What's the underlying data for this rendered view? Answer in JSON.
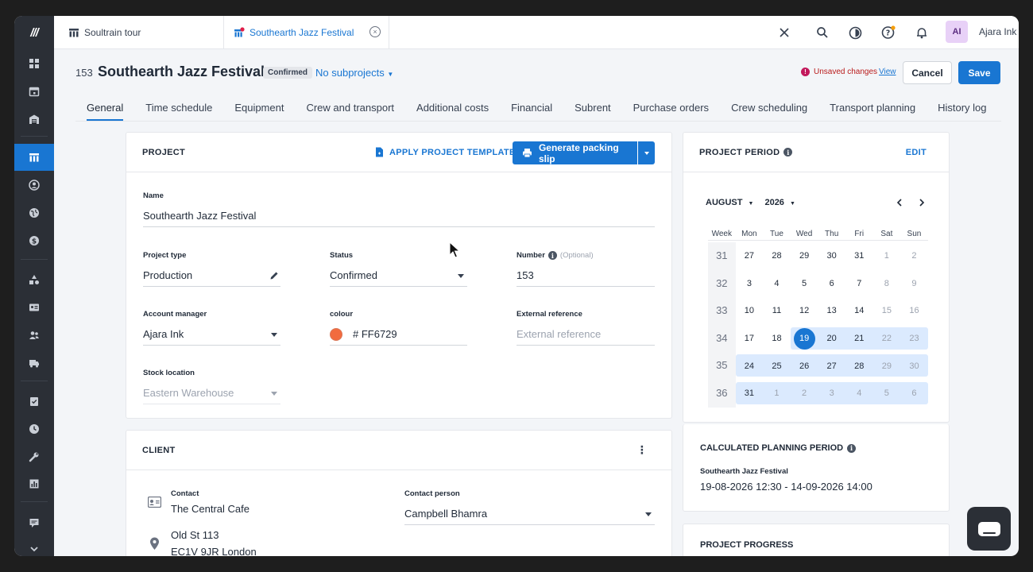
{
  "app": {
    "logo": "///"
  },
  "tabs": {
    "tab1": "Soultrain tour",
    "tab2": "Southearth Jazz Festival",
    "tab2_close": "×"
  },
  "topbar": {
    "user_initials": "AI",
    "user_name": "Ajara Ink"
  },
  "header": {
    "number": "153",
    "title": "Southearth Jazz Festival",
    "status_badge": "Confirmed",
    "subprojects": "No subprojects",
    "unsaved_icon": "!",
    "unsaved": "Unsaved changes",
    "view": "View",
    "cancel": "Cancel",
    "save": "Save"
  },
  "nav_tabs": [
    "General",
    "Time schedule",
    "Equipment",
    "Crew and transport",
    "Additional costs",
    "Financial",
    "Subrent",
    "Purchase orders",
    "Crew scheduling",
    "Transport planning",
    "History log"
  ],
  "project": {
    "section": "PROJECT",
    "apply_template": "APPLY PROJECT TEMPLATE",
    "generate": "Generate packing slip",
    "name_label": "Name",
    "name_value": "Southearth Jazz Festival",
    "type_label": "Project type",
    "type_value": "Production",
    "status_label": "Status",
    "status_value": "Confirmed",
    "number_label": "Number",
    "number_optional": "(Optional)",
    "number_value": "153",
    "manager_label": "Account manager",
    "manager_value": "Ajara Ink",
    "colour_label": "colour",
    "colour_value": "# FF6729",
    "colour_hex": "#F26B3F",
    "extref_label": "External reference",
    "extref_placeholder": "External reference",
    "stock_label": "Stock location",
    "stock_value": "Eastern Warehouse"
  },
  "client": {
    "section": "CLIENT",
    "menu_icon": "⋮",
    "contact_label": "Contact",
    "contact_value": "The Central Cafe",
    "person_label": "Contact person",
    "person_value": "Campbell Bhamra",
    "address_line1": "Old St 113",
    "address_line2": "EC1V 9JR London"
  },
  "period": {
    "section": "PROJECT PERIOD",
    "edit": "EDIT",
    "month": "AUGUST",
    "year": "2026",
    "week_header": "Week",
    "days": [
      "Mon",
      "Tue",
      "Wed",
      "Thu",
      "Fri",
      "Sat",
      "Sun"
    ],
    "weeks": [
      {
        "week": "31",
        "days": [
          "27",
          "28",
          "29",
          "30",
          "31",
          "1",
          "2"
        ]
      },
      {
        "week": "32",
        "days": [
          "3",
          "4",
          "5",
          "6",
          "7",
          "8",
          "9"
        ]
      },
      {
        "week": "33",
        "days": [
          "10",
          "11",
          "12",
          "13",
          "14",
          "15",
          "16"
        ]
      },
      {
        "week": "34",
        "days": [
          "17",
          "18",
          "19",
          "20",
          "21",
          "22",
          "23"
        ]
      },
      {
        "week": "35",
        "days": [
          "24",
          "25",
          "26",
          "27",
          "28",
          "29",
          "30"
        ]
      },
      {
        "week": "36",
        "days": [
          "31",
          "1",
          "2",
          "3",
          "4",
          "5",
          "6"
        ]
      }
    ],
    "selected_day": "19"
  },
  "planning": {
    "section": "CALCULATED PLANNING PERIOD",
    "project_name": "Southearth Jazz Festival",
    "range": "19-08-2026 12:30 - 14-09-2026 14:00"
  },
  "progress": {
    "section": "PROJECT PROGRESS"
  },
  "colors": {
    "accent": "#1976d2",
    "rail": "#2b2f36"
  }
}
